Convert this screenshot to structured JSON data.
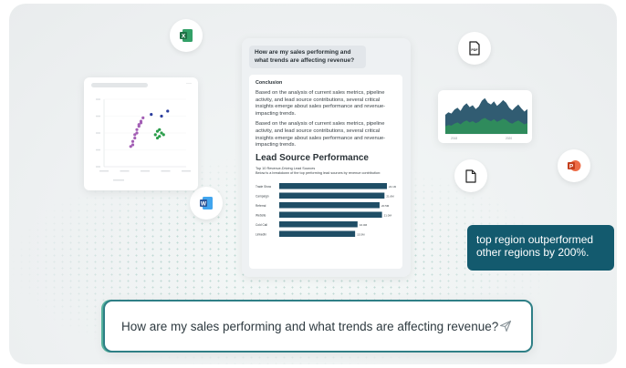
{
  "doc": {
    "question": "How are my sales performing and what trends are affecting revenue?",
    "conclusion_heading": "Conclusion",
    "paragraphs": [
      "Based on the analysis of current sales metrics, pipeline activity, and lead source contributions, several critical insights emerge about sales performance and revenue-impacting trends.",
      "Based on the analysis of current sales metrics, pipeline activity, and lead source contributions, several critical insights emerge about sales performance and revenue-impacting trends."
    ],
    "section_title": "Lead Source Performance",
    "chart_caption": "Top 10 Revenue-Driving Lead Sources",
    "chart_subcaption": "Below is a breakdown of the top performing lead sources by revenue contribution:"
  },
  "chart_data": [
    {
      "type": "bar",
      "orientation": "horizontal",
      "title": "Top 10 Revenue-Driving Lead Sources",
      "categories": [
        "Trade Show",
        "Campaign",
        "Referral",
        "Website",
        "Cold Call",
        "LinkedIn"
      ],
      "values": [
        22,
        21.5,
        20.5,
        21,
        16,
        15.5
      ],
      "data_labels": [
        "22.1M",
        "21.6M",
        "20.5M",
        "21.0M",
        "16.0M",
        "15.5M"
      ],
      "bar_color": "#1f4e66"
    },
    {
      "type": "scatter",
      "series": [
        {
          "color": "#a35fb5",
          "points": [
            [
              1.3,
              3.2
            ],
            [
              1.4,
              3.5
            ],
            [
              1.5,
              3.9
            ],
            [
              1.6,
              4.2
            ],
            [
              1.7,
              4.5
            ],
            [
              1.8,
              4.7
            ],
            [
              1.9,
              4.9
            ],
            [
              1.5,
              3.7
            ],
            [
              1.7,
              4.4
            ],
            [
              1.4,
              3.3
            ],
            [
              1.8,
              4.6
            ],
            [
              1.6,
              4.0
            ]
          ]
        },
        {
          "color": "#2a9d4a",
          "points": [
            [
              2.5,
              3.9
            ],
            [
              2.6,
              4.1
            ],
            [
              2.7,
              3.8
            ],
            [
              2.8,
              4.0
            ],
            [
              2.6,
              3.7
            ],
            [
              2.9,
              3.9
            ],
            [
              2.7,
              4.2
            ]
          ]
        },
        {
          "color": "#2c3e9e",
          "points": [
            [
              2.3,
              5.1
            ],
            [
              2.8,
              5.0
            ],
            [
              3.1,
              5.3
            ]
          ]
        }
      ],
      "xlim": [
        0,
        4
      ],
      "ylim": [
        2,
        6
      ]
    },
    {
      "type": "area",
      "x_tick_labels": [
        "2018",
        "2020"
      ],
      "series": [
        {
          "color": "#1f4e66",
          "values": [
            3,
            3.4,
            3.2,
            3.8,
            4.1,
            3.6,
            4.4,
            4.8,
            4.2,
            4.5,
            3.9,
            4.3,
            5.2,
            5.6,
            4.9,
            4.6,
            5.1,
            4.4,
            4.8,
            5.3,
            4.9,
            4.1,
            3.7,
            4.2,
            4.6,
            4.0,
            3.5,
            3.9
          ]
        },
        {
          "color": "#2f8f5a",
          "values": [
            1.2,
            1.4,
            1.3,
            1.6,
            1.8,
            1.5,
            1.9,
            2.1,
            1.8,
            2.0,
            1.7,
            1.9,
            2.3,
            2.5,
            2.2,
            2.0,
            2.3,
            1.9,
            2.1,
            2.4,
            2.2,
            1.8,
            1.6,
            1.9,
            2.1,
            1.8,
            1.5,
            1.7
          ]
        }
      ]
    }
  ],
  "callout": {
    "text": "top region outperformed other regions by 200%."
  },
  "prompt": {
    "text": "How are my sales performing and what trends are affecting revenue?"
  },
  "colors": {
    "accent": "#135a6e",
    "prompt_border": "#2f7f86",
    "excel": "#1e7145",
    "word": "#2b579a",
    "powerpoint": "#d24726"
  },
  "icons": {
    "excel": "excel-icon",
    "pdf": "pdf-icon",
    "file": "file-icon",
    "powerpoint": "powerpoint-icon",
    "word": "word-icon",
    "send": "send-icon"
  }
}
